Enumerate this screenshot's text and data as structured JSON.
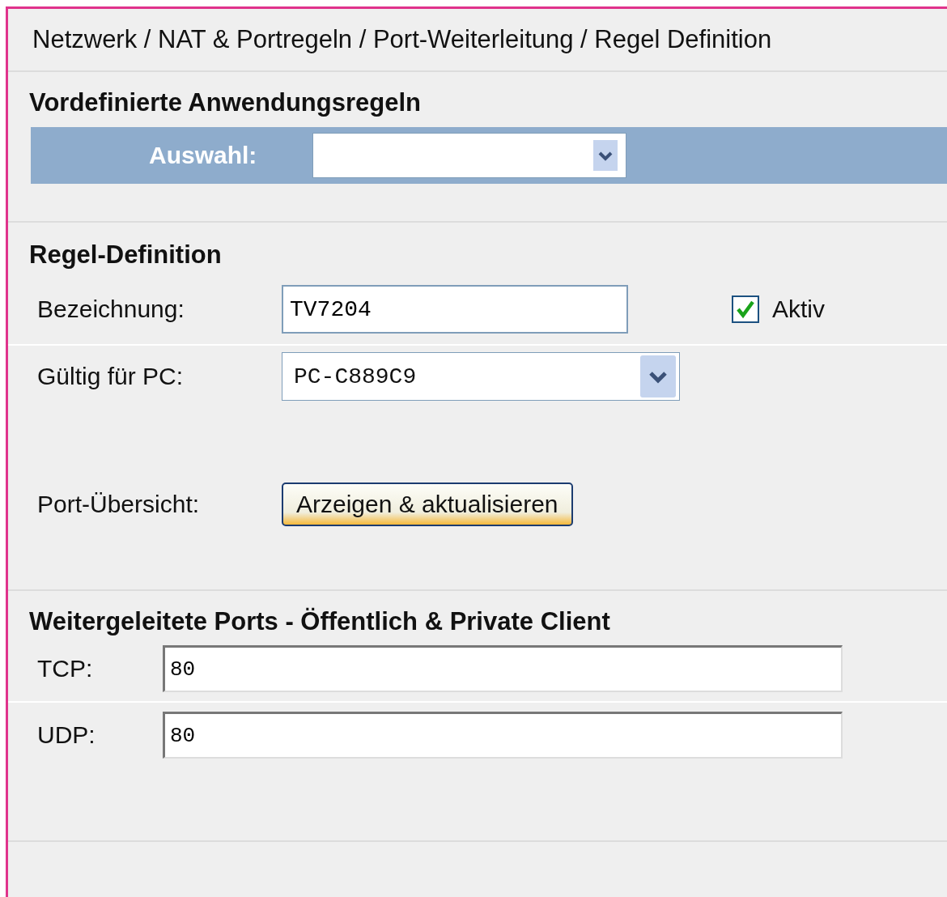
{
  "breadcrumb": "Netzwerk / NAT & Portregeln / Port-Weiterleitung / Regel Definition",
  "predefined": {
    "heading": "Vordefinierte Anwendungsregeln",
    "label": "Auswahl:"
  },
  "rule": {
    "heading": "Regel-Definition",
    "name_label": "Bezeichnung:",
    "name_value": "TV7204",
    "active": {
      "label": "Aktiv",
      "checked": true
    },
    "pc_label": "Gültig für PC:",
    "pc_value": "PC-C889C9",
    "overview_label": "Port-Übersicht:",
    "overview_button": "Arzeigen & aktualisieren"
  },
  "ports": {
    "heading": "Weitergeleitete Ports - Öffentlich & Private Client",
    "fields": [
      {
        "label": "TCP:",
        "value": "80"
      },
      {
        "label": "UDP:",
        "value": "80"
      }
    ]
  }
}
